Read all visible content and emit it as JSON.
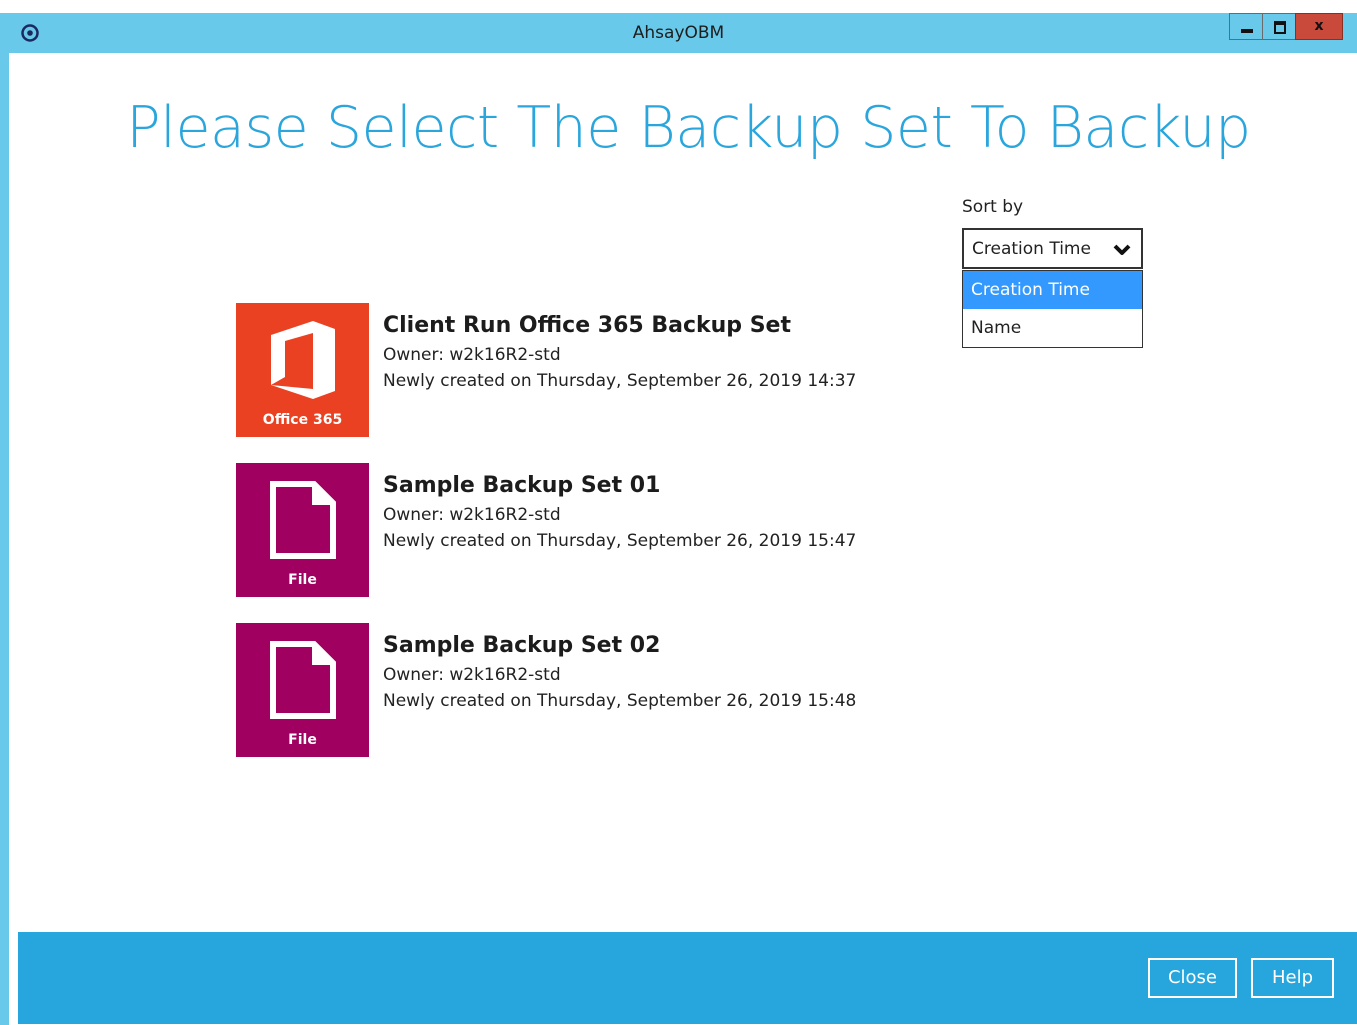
{
  "window": {
    "title": "AhsayOBM",
    "controls": {
      "minimize_icon": "minimize-icon",
      "maximize_icon": "maximize-icon",
      "close_label": "x"
    }
  },
  "main": {
    "heading": "Please Select The Backup Set To Backup",
    "sort": {
      "label": "Sort by",
      "selected": "Creation Time",
      "options": [
        "Creation Time",
        "Name"
      ]
    },
    "backup_sets": [
      {
        "name": "Client Run Office 365 Backup Set",
        "owner": "Owner: w2k16R2-std",
        "created": "Newly created on Thursday, September 26, 2019 14:37",
        "tile_label": "Office 365",
        "tile_icon": "office365-icon",
        "tile_color": "#e94122"
      },
      {
        "name": "Sample Backup Set 01",
        "owner": "Owner: w2k16R2-std",
        "created": "Newly created on Thursday, September 26, 2019 15:47",
        "tile_label": "File",
        "tile_icon": "file-icon",
        "tile_color": "#a0005f"
      },
      {
        "name": "Sample Backup Set 02",
        "owner": "Owner: w2k16R2-std",
        "created": "Newly created on Thursday, September 26, 2019 15:48",
        "tile_label": "File",
        "tile_icon": "file-icon",
        "tile_color": "#a0005f"
      }
    ]
  },
  "footer": {
    "close_label": "Close",
    "help_label": "Help"
  },
  "colors": {
    "titlebar": "#69c9ea",
    "heading": "#2aa6dd",
    "footer": "#26a6dd",
    "dropdown_highlight": "#3399ff"
  }
}
